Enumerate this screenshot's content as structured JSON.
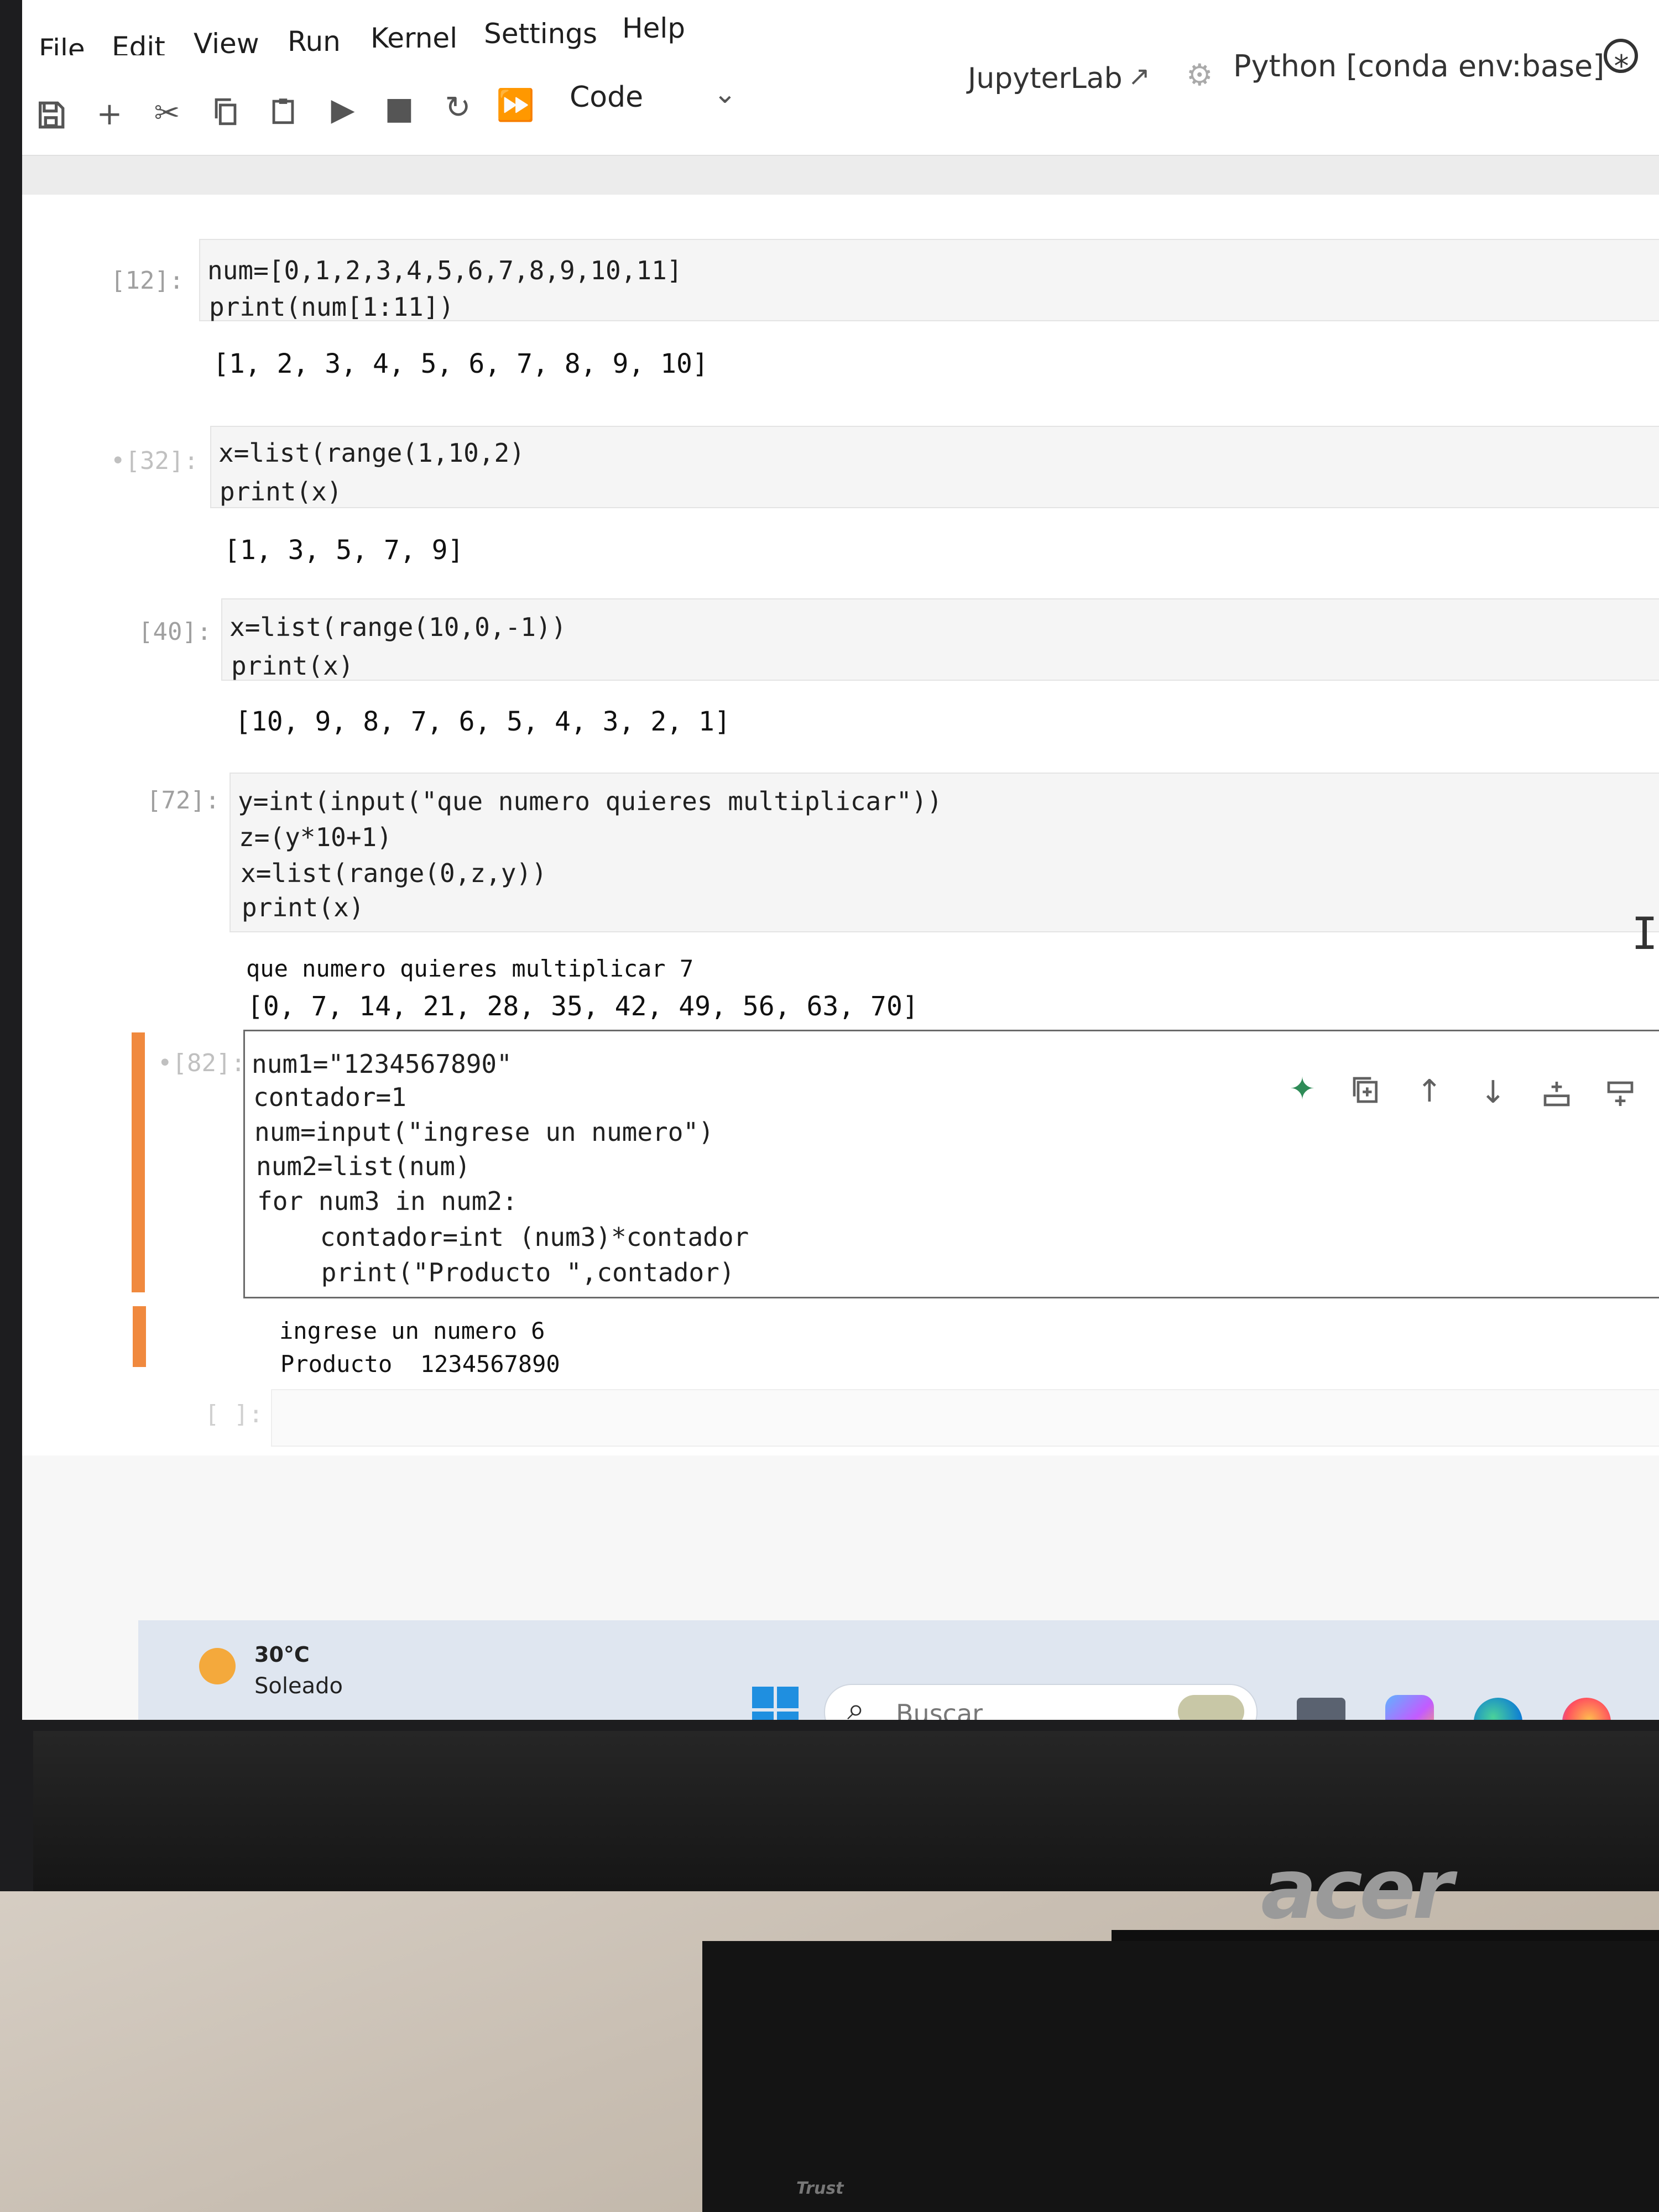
{
  "menubar": {
    "items": [
      "File",
      "Edit",
      "View",
      "Run",
      "Kernel",
      "Settings",
      "Help"
    ]
  },
  "toolbar": {
    "cell_type": "Code",
    "jupyterlab_label": "JupyterLab",
    "kernel_label": "Python [conda env:base] *"
  },
  "cells": [
    {
      "prompt": "[12]:",
      "code": [
        "num=[0,1,2,3,4,5,6,7,8,9,10,11]",
        "print(num[1:11])"
      ],
      "output": [
        "[1, 2, 3, 4, 5, 6, 7, 8, 9, 10]"
      ]
    },
    {
      "prompt": "•[32]:",
      "code": [
        "x=list(range(1,10,2)",
        "print(x)"
      ],
      "output": [
        "[1, 3, 5, 7, 9]"
      ]
    },
    {
      "prompt": "[40]:",
      "code": [
        "x=list(range(10,0,-1))",
        "print(x)"
      ],
      "output": [
        "[10, 9, 8, 7, 6, 5, 4, 3, 2, 1]"
      ]
    },
    {
      "prompt": "[72]:",
      "code": [
        "y=int(input(\"que numero quieres multiplicar\"))",
        "z=(y*10+1)",
        "x=list(range(0,z,y))",
        "print(x)"
      ],
      "output": [
        "que numero quieres multiplicar 7",
        "[0, 7, 14, 21, 28, 35, 42, 49, 56, 63, 70]"
      ]
    },
    {
      "prompt": "•[82]:",
      "code": [
        "num1=\"1234567890\"",
        "contador=1",
        "num=input(\"ingrese un numero\")",
        "num2=list(num)",
        "for num3 in num2:",
        "    contador=int (num3)*contador",
        "    print(\"Producto \",contador)"
      ],
      "output": [
        "ingrese un numero 6",
        "Producto  1234567890"
      ]
    },
    {
      "prompt": "[ ]:"
    }
  ],
  "taskbar": {
    "weather_temp": "30°C",
    "weather_desc": "Soleado",
    "search_placeholder": "Buscar"
  },
  "monitor": {
    "brand": "acer"
  },
  "stand_label": "Trust"
}
